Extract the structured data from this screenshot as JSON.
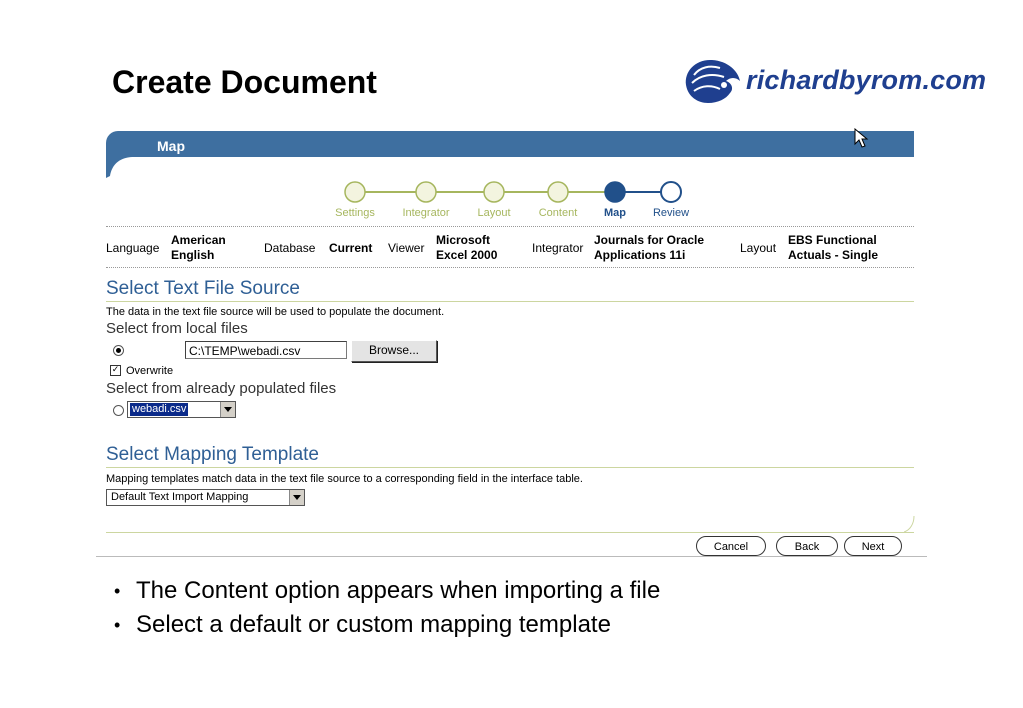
{
  "slide": {
    "title": "Create Document",
    "logo_text": "richardbyrom.com",
    "bullets": [
      "The Content option appears when importing a file",
      "Select a default or custom mapping template"
    ]
  },
  "header": {
    "title": "Map"
  },
  "train": {
    "steps": [
      {
        "label": "Settings",
        "state": "visited"
      },
      {
        "label": "Integrator",
        "state": "visited"
      },
      {
        "label": "Layout",
        "state": "visited"
      },
      {
        "label": "Content",
        "state": "visited"
      },
      {
        "label": "Map",
        "state": "current"
      },
      {
        "label": "Review",
        "state": "next"
      }
    ]
  },
  "context": {
    "language_label": "Language",
    "language_value_1": "American",
    "language_value_2": "English",
    "database_label": "Database",
    "database_value": "Current",
    "viewer_label": "Viewer",
    "viewer_value_1": "Microsoft",
    "viewer_value_2": "Excel 2000",
    "integrator_label": "Integrator",
    "integrator_value_1": "Journals for Oracle",
    "integrator_value_2": "Applications 11i",
    "layout_label": "Layout",
    "layout_value_1": "EBS Functional",
    "layout_value_2": "Actuals - Single"
  },
  "text_source": {
    "heading": "Select Text File Source",
    "description": "The data in the text file source will be used to populate the document.",
    "local_label": "Select from local files",
    "file_path": "C:\\TEMP\\webadi.csv",
    "browse_label": "Browse...",
    "overwrite_label": "Overwrite",
    "overwrite_checked": true,
    "populated_label": "Select from already populated files",
    "populated_selected": "webadi.csv"
  },
  "mapping": {
    "heading": "Select Mapping Template",
    "description": "Mapping templates match data in the text file source to a corresponding field in the interface table.",
    "selected": "Default Text Import Mapping"
  },
  "buttons": {
    "cancel": "Cancel",
    "back": "Back",
    "next": "Next"
  },
  "colors": {
    "header_bar": "#3e6fa0",
    "section_heading": "#2f5f95",
    "train_visited": "#a6b65e",
    "train_current": "#21508a"
  }
}
